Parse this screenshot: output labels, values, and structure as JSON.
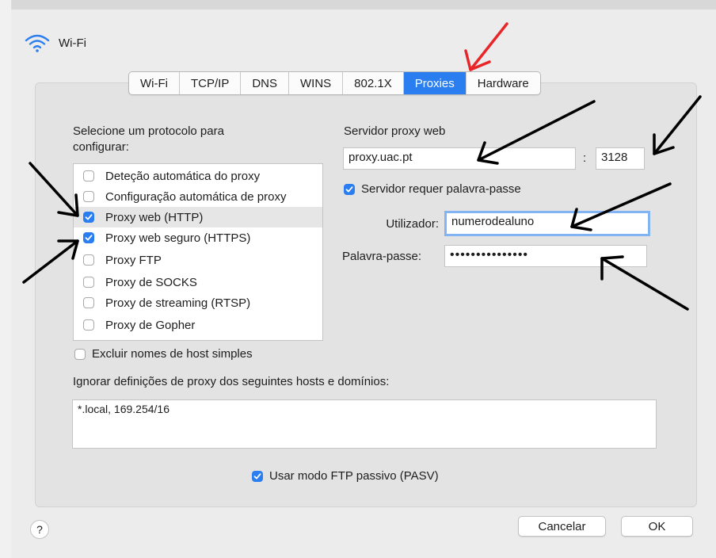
{
  "window": {
    "title": "Wi-Fi"
  },
  "tabs": [
    {
      "label": "Wi-Fi",
      "active": false
    },
    {
      "label": "TCP/IP",
      "active": false
    },
    {
      "label": "DNS",
      "active": false
    },
    {
      "label": "WINS",
      "active": false
    },
    {
      "label": "802.1X",
      "active": false
    },
    {
      "label": "Proxies",
      "active": true
    },
    {
      "label": "Hardware",
      "active": false
    }
  ],
  "protocols": {
    "heading_line1": "Selecione um protocolo para",
    "heading_line2": "configurar:",
    "items": [
      {
        "label": "Deteção automática do proxy",
        "checked": false
      },
      {
        "label": "Configuração automática de proxy",
        "checked": false
      },
      {
        "label": "Proxy web (HTTP)",
        "checked": true,
        "selected": true
      },
      {
        "label": "Proxy web seguro (HTTPS)",
        "checked": true
      },
      {
        "label": "Proxy FTP",
        "checked": false
      },
      {
        "label": "Proxy de SOCKS",
        "checked": false
      },
      {
        "label": "Proxy de streaming (RTSP)",
        "checked": false
      },
      {
        "label": "Proxy de Gopher",
        "checked": false
      }
    ]
  },
  "proxy": {
    "server_label": "Servidor proxy web",
    "server_value": "proxy.uac.pt",
    "port_separator": ":",
    "port_value": "3128",
    "requires_password_label": "Servidor requer palavra-passe",
    "requires_password_checked": true,
    "user_label": "Utilizador:",
    "user_value": "numerodealuno",
    "password_label": "Palavra-passe:",
    "password_mask": "•••••••••••••••"
  },
  "exclude_simple_hosts": {
    "label": "Excluir nomes de host simples",
    "checked": false
  },
  "bypass": {
    "label": "Ignorar definições de proxy dos seguintes hosts e domínios:",
    "value": "*.local, 169.254/16"
  },
  "passive_ftp": {
    "label": "Usar modo FTP passivo (PASV)",
    "checked": true
  },
  "buttons": {
    "help": "?",
    "cancel": "Cancelar",
    "ok": "OK"
  },
  "colors": {
    "accent": "#2b7ef0",
    "annotation_red": "#e8262a",
    "annotation_black": "#000000"
  }
}
